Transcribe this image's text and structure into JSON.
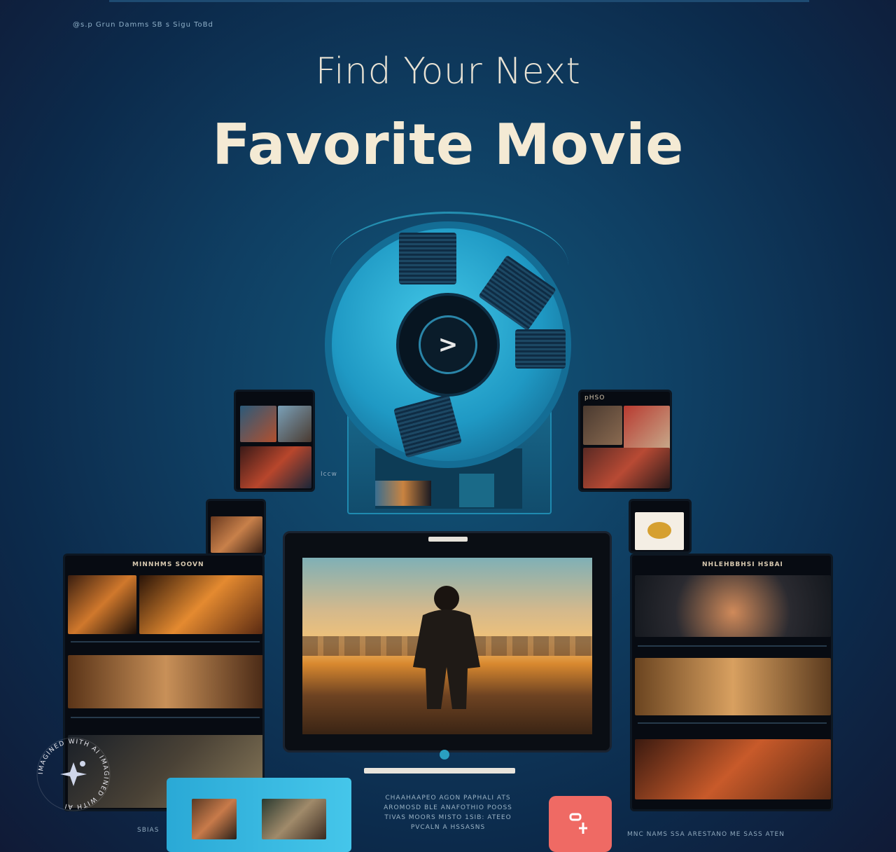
{
  "header": {
    "small_text": "@s.p Grun Damms  SB  s Sigu ToBd",
    "headline_light": "Find Your Next",
    "headline_bold": "Favorite Movie"
  },
  "reel": {
    "play_label": ">"
  },
  "cards": {
    "left_tablet_title": "MINNHMS SOOVN",
    "right_tablet_title": "NHLEHBBHSI HSBAI",
    "side_label": "Iccw",
    "top_right_title": "pHSO"
  },
  "center_text": {
    "line1": "CHAAHAAPEO AGON PAPHALI ATS",
    "line2": "AROMOSD BLE ANAFOTHIO POOSS",
    "line3": "TIVAS MOORS MISTO 1SIB: ATEEO",
    "line4": "PVCALN A HSSASNS"
  },
  "bottom_right_text": "MNC NAMS SSA ARESTANO ME  SASS ATEN",
  "bottom_left_text": "SBIAS",
  "watermark": "IMAGINED WITH AI  IMAGINED WITH AI",
  "colors": {
    "background": "#0f3f63",
    "accent": "#2aa0c2",
    "title": "#f4ead4",
    "app_red": "#ef6a64"
  },
  "icons": [
    "play-icon",
    "sparkle-icon"
  ]
}
